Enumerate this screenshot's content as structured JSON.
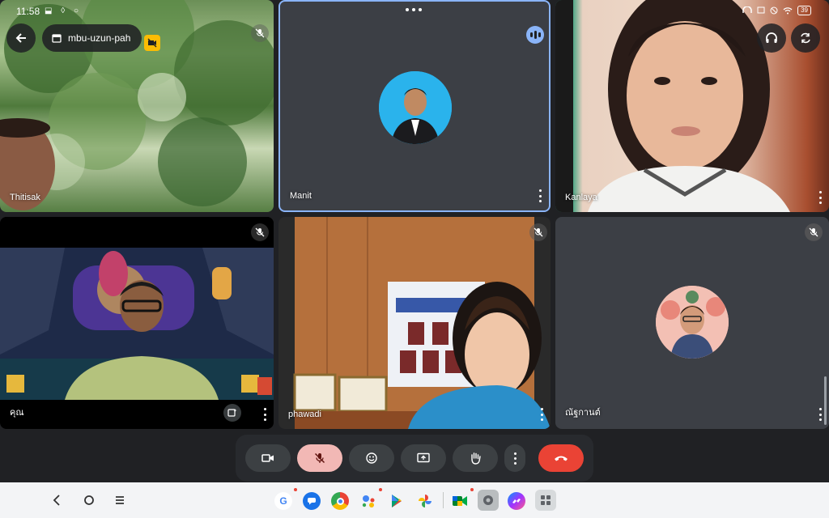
{
  "status_bar": {
    "time": "11:58",
    "left_icons": "⬓ ◊ ○",
    "battery": "39"
  },
  "meeting": {
    "code": "mbu-uzun-pah"
  },
  "participants": [
    {
      "name": "Thitisak"
    },
    {
      "name": "Manit"
    },
    {
      "name": "Kanlaya"
    },
    {
      "name": "คุณ"
    },
    {
      "name": "phawadi"
    },
    {
      "name": "ณัฐกานต์"
    }
  ],
  "controls": [
    {
      "icon": "camera-icon"
    },
    {
      "icon": "mic-off-icon",
      "active_color": "#f2b8b5"
    },
    {
      "icon": "emoji-icon"
    },
    {
      "icon": "present-icon"
    },
    {
      "icon": "raise-hand-icon"
    },
    {
      "icon": "more-icon"
    },
    {
      "icon": "end-call-icon",
      "color": "#ea4335"
    }
  ],
  "taskbar": {
    "apps": [
      "google-icon",
      "messages-icon",
      "chrome-icon",
      "assistant-icon",
      "play-store-icon",
      "photos-icon",
      "meet-icon",
      "settings-icon",
      "messenger-icon",
      "app-drawer-icon"
    ]
  },
  "colors": {
    "accent": "#8ab4f8",
    "end_call": "#ea4335",
    "mic_off": "#f2b8b5"
  }
}
